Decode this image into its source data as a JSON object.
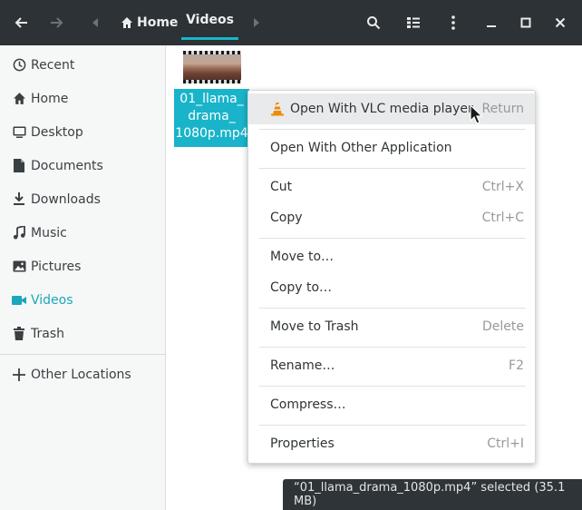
{
  "header": {
    "breadcrumb_home": "Home",
    "breadcrumb_current": "Videos"
  },
  "sidebar": {
    "items": [
      {
        "label": "Recent",
        "icon": "clock-icon"
      },
      {
        "label": "Home",
        "icon": "home-icon"
      },
      {
        "label": "Desktop",
        "icon": "desktop-icon"
      },
      {
        "label": "Documents",
        "icon": "document-icon"
      },
      {
        "label": "Downloads",
        "icon": "download-icon"
      },
      {
        "label": "Music",
        "icon": "music-icon"
      },
      {
        "label": "Pictures",
        "icon": "image-icon"
      },
      {
        "label": "Videos",
        "icon": "video-icon"
      },
      {
        "label": "Trash",
        "icon": "trash-icon"
      }
    ],
    "other_locations": "Other Locations"
  },
  "file": {
    "name_lines": [
      "01_llama_",
      "drama_",
      "1080p.mp4"
    ]
  },
  "menu": {
    "open_vlc": {
      "label": "Open With VLC media player",
      "shortcut": "Return"
    },
    "open_other": {
      "label": "Open With Other Application"
    },
    "cut": {
      "label": "Cut",
      "shortcut": "Ctrl+X"
    },
    "copy": {
      "label": "Copy",
      "shortcut": "Ctrl+C"
    },
    "move_to": {
      "label": "Move to…"
    },
    "copy_to": {
      "label": "Copy to…"
    },
    "trash": {
      "label": "Move to Trash",
      "shortcut": "Delete"
    },
    "rename": {
      "label": "Rename…",
      "shortcut": "F2"
    },
    "compress": {
      "label": "Compress…"
    },
    "properties": {
      "label": "Properties",
      "shortcut": "Ctrl+I"
    }
  },
  "status": {
    "text": "“01_llama_drama_1080p.mp4” selected  (35.1 MB)"
  },
  "colors": {
    "accent": "#19b4c9",
    "header_bg": "#2c3236",
    "sidebar_bg": "#f6f7f7",
    "vlc_orange": "#f08a00"
  }
}
